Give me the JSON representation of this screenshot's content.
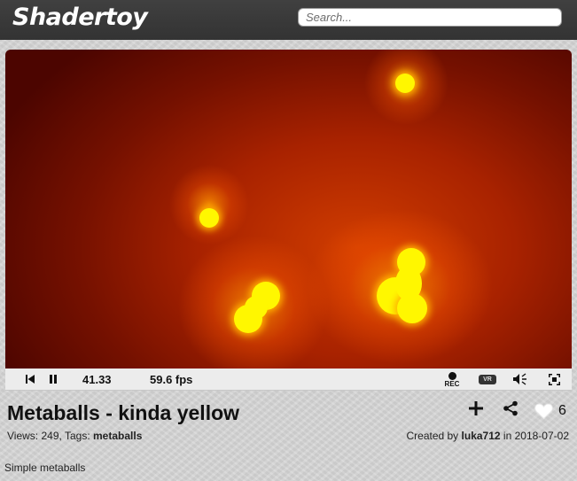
{
  "app": {
    "logo": "Shadertoy"
  },
  "search": {
    "placeholder": "Search..."
  },
  "player": {
    "time": "41.33",
    "fps": "59.6 fps",
    "rec_label": "REC",
    "vr_label": "VR"
  },
  "shader": {
    "title": "Metaballs - kinda yellow",
    "views_label": "Views:",
    "views": "249",
    "tags_label": "Tags:",
    "tags": "metaballs",
    "created_by_label": "Created by",
    "author": "luka712",
    "in_label": "in",
    "date": "2018-07-02",
    "likes": "6",
    "description": "Simple metaballs"
  },
  "colors": {
    "topbar": "#3a3a3a",
    "metaball": "#fff700",
    "background_dark": "#4c0500",
    "background_glow": "#d03d00"
  }
}
